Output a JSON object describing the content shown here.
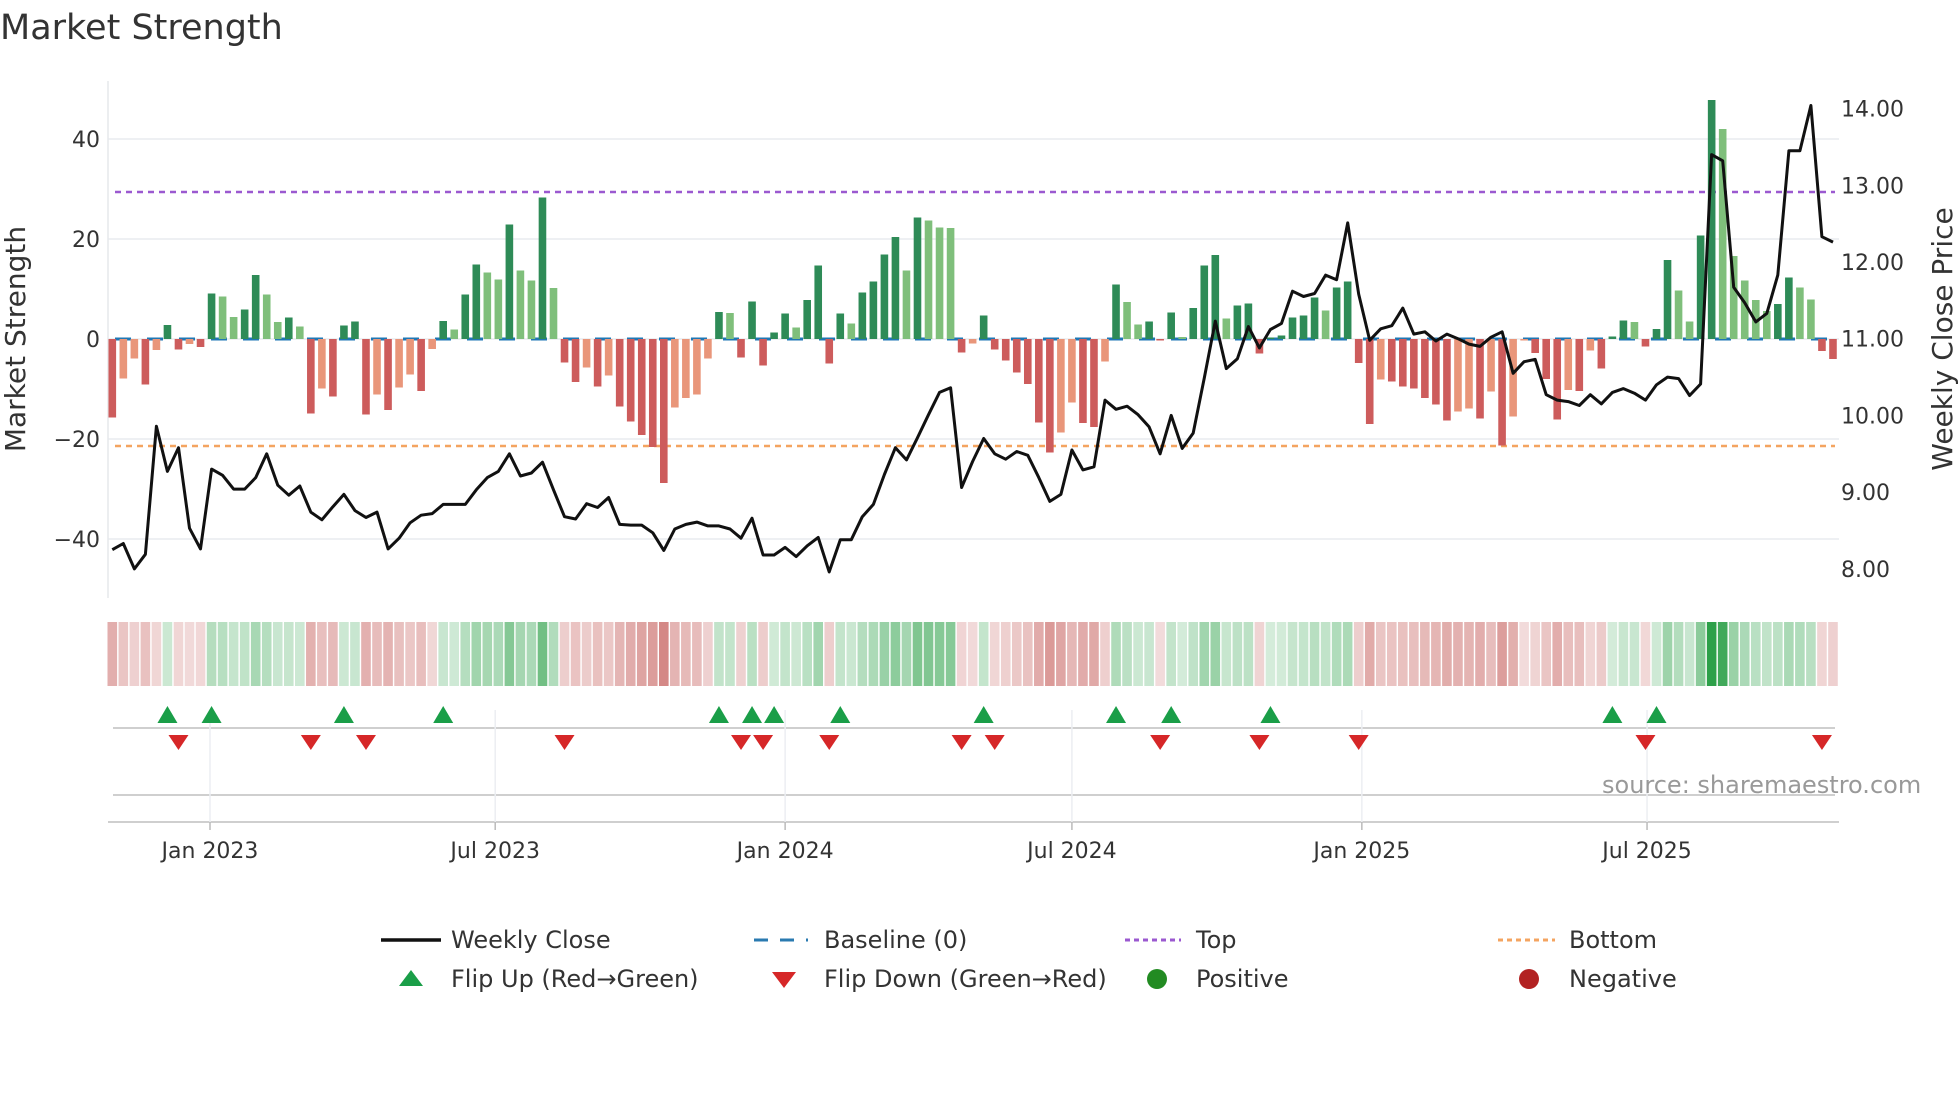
{
  "title": "Market Strength",
  "source": "source: sharemaestro.com",
  "colors": {
    "pos_dark": "#2e8b57",
    "pos_light": "#7fbf7b",
    "neg_dark": "#cd5c5c",
    "neg_light": "#e9967a",
    "baseline": "#1f77b4",
    "top": "#9b59d0",
    "bottom": "#f4a460",
    "line": "#111111",
    "flip_up": "#1a9e48",
    "flip_down": "#d62728",
    "positive": "#228b22",
    "negative": "#b22222"
  },
  "legend": {
    "weekly_close": "Weekly Close",
    "baseline": "Baseline (0)",
    "top": "Top",
    "bottom": "Bottom",
    "flip_up": "Flip Up (Red→Green)",
    "flip_down": "Flip Down (Green→Red)",
    "positive": "Positive",
    "negative": "Negative"
  },
  "chart_data": {
    "type": "bar+line",
    "title": "Market Strength",
    "ylabel": "Market Strength",
    "y2label": "Weekly Close Price",
    "ylim": [
      -51.8,
      51.6
    ],
    "y2lim": [
      7.62,
      14.36
    ],
    "yticks": [
      {
        "v": 40,
        "label": "40"
      },
      {
        "v": 20,
        "label": "20"
      },
      {
        "v": 0,
        "label": "0"
      },
      {
        "v": -20,
        "label": "−20"
      },
      {
        "v": -40,
        "label": "−40"
      }
    ],
    "y2ticks": [
      {
        "v": 14,
        "label": "14.00"
      },
      {
        "v": 13,
        "label": "13.00"
      },
      {
        "v": 12,
        "label": "12.00"
      },
      {
        "v": 11,
        "label": "11.00"
      },
      {
        "v": 10,
        "label": "10.00"
      },
      {
        "v": 9,
        "label": "9.00"
      },
      {
        "v": 8,
        "label": "8.00"
      }
    ],
    "xticks": [
      {
        "date": "2023-01-01",
        "label": "Jan 2023"
      },
      {
        "date": "2023-07-01",
        "label": "Jul 2023"
      },
      {
        "date": "2024-01-01",
        "label": "Jan 2024"
      },
      {
        "date": "2024-07-01",
        "label": "Jul 2024"
      },
      {
        "date": "2025-01-01",
        "label": "Jan 2025"
      },
      {
        "date": "2025-07-01",
        "label": "Jul 2025"
      }
    ],
    "start_date": "2022-10-31",
    "frequency": "weekly",
    "top_level": 29.4,
    "bottom_level": -21.4,
    "baseline": 0,
    "strength": [
      -15.7,
      -7.9,
      -3.9,
      -9.1,
      -2.2,
      2.8,
      -2.1,
      -1.0,
      -1.6,
      9.1,
      8.5,
      4.4,
      5.9,
      12.8,
      8.9,
      3.4,
      4.3,
      2.5,
      -14.9,
      -9.9,
      -11.5,
      2.7,
      3.5,
      -15.1,
      -11.1,
      -14.2,
      -9.7,
      -7.1,
      -10.4,
      -2.0,
      3.6,
      1.9,
      8.9,
      14.9,
      13.3,
      11.9,
      22.9,
      13.7,
      11.7,
      28.3,
      10.2,
      -4.7,
      -8.6,
      -5.7,
      -9.5,
      -7.3,
      -13.5,
      -16.5,
      -19.2,
      -21.6,
      -28.8,
      -13.7,
      -11.8,
      -11.1,
      -3.9,
      5.4,
      5.2,
      -3.7,
      7.5,
      -5.3,
      1.3,
      5.1,
      2.3,
      7.8,
      14.7,
      -4.9,
      5.1,
      3.1,
      9.3,
      11.5,
      16.9,
      20.4,
      13.7,
      24.3,
      23.7,
      22.3,
      22.2,
      -2.7,
      -0.9,
      4.7,
      -2.1,
      -4.3,
      -6.7,
      -9.0,
      -16.7,
      -22.7,
      -18.7,
      -12.7,
      -16.8,
      -17.6,
      -4.5,
      10.9,
      7.4,
      2.9,
      3.5,
      -0.3,
      5.3,
      0.4,
      6.2,
      14.7,
      16.8,
      4.1,
      6.7,
      7.1,
      -2.9,
      0.3,
      0.7,
      4.3,
      4.7,
      8.3,
      5.7,
      10.3,
      11.5,
      -4.8,
      -17.0,
      -8.1,
      -8.5,
      -9.5,
      -9.9,
      -11.8,
      -13.1,
      -16.3,
      -14.5,
      -13.9,
      -15.9,
      -10.5,
      -21.3,
      -15.5,
      -0.3,
      -2.8,
      -8.0,
      -16.1,
      -10.2,
      -10.4,
      -2.3,
      -5.9,
      0.5,
      3.7,
      3.4,
      -1.5,
      2.0,
      15.8,
      9.7,
      3.5,
      20.7,
      47.8,
      42.0,
      16.6,
      11.7,
      7.8,
      5.6,
      7.0,
      12.3,
      10.3,
      7.9,
      -2.4,
      -4.0
    ],
    "close": [
      8.25,
      8.33,
      8.0,
      8.19,
      9.86,
      9.27,
      9.58,
      8.53,
      8.26,
      9.3,
      9.22,
      9.04,
      9.04,
      9.19,
      9.5,
      9.09,
      8.96,
      9.08,
      8.74,
      8.64,
      8.81,
      8.97,
      8.76,
      8.67,
      8.74,
      8.26,
      8.4,
      8.6,
      8.7,
      8.72,
      8.84,
      8.84,
      8.84,
      9.03,
      9.19,
      9.27,
      9.5,
      9.21,
      9.25,
      9.39,
      9.03,
      8.68,
      8.65,
      8.85,
      8.8,
      8.93,
      8.58,
      8.57,
      8.57,
      8.47,
      8.24,
      8.52,
      8.58,
      8.61,
      8.56,
      8.56,
      8.52,
      8.4,
      8.66,
      8.18,
      8.18,
      8.28,
      8.16,
      8.3,
      8.41,
      7.96,
      8.38,
      8.38,
      8.68,
      8.84,
      9.23,
      9.58,
      9.42,
      9.71,
      10.01,
      10.3,
      10.36,
      9.06,
      9.4,
      9.7,
      9.5,
      9.43,
      9.53,
      9.48,
      9.19,
      8.88,
      8.97,
      9.55,
      9.29,
      9.33,
      10.2,
      10.08,
      10.12,
      10.01,
      9.85,
      9.5,
      10.0,
      9.57,
      9.77,
      10.49,
      11.23,
      10.61,
      10.74,
      11.16,
      10.88,
      11.12,
      11.2,
      11.62,
      11.55,
      11.59,
      11.83,
      11.77,
      12.51,
      11.58,
      10.98,
      11.13,
      11.17,
      11.4,
      11.06,
      11.09,
      10.97,
      11.06,
      11.0,
      10.93,
      10.9,
      11.02,
      11.09,
      10.55,
      10.7,
      10.73,
      10.27,
      10.2,
      10.18,
      10.13,
      10.27,
      10.15,
      10.3,
      10.35,
      10.29,
      10.2,
      10.4,
      10.5,
      10.48,
      10.26,
      10.41,
      13.4,
      13.32,
      11.67,
      11.47,
      11.22,
      11.33,
      11.83,
      13.45,
      13.45,
      14.04,
      12.33,
      12.26
    ],
    "legend_position": "bottom"
  }
}
